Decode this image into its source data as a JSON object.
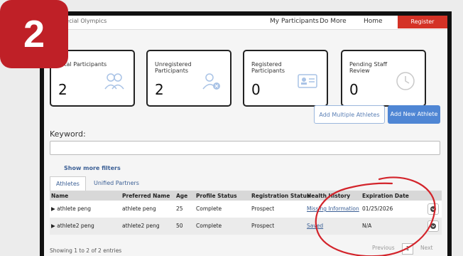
{
  "step_badge": "2",
  "nav": {
    "logo_text": "Special Olympics",
    "links": [
      "My Participants",
      "Do More",
      "Home"
    ],
    "cta": "Register"
  },
  "cards": [
    {
      "title": "Total Participants",
      "value": "2",
      "icon": "group-icon"
    },
    {
      "title": "Unregistered Participants",
      "value": "2",
      "icon": "user-remove-icon"
    },
    {
      "title": "Registered Participants",
      "value": "0",
      "icon": "id-card-icon"
    },
    {
      "title": "Pending Staff Review",
      "value": "0",
      "icon": "clock-icon"
    }
  ],
  "actions": {
    "add_multiple": "Add Multiple Athletes",
    "add_new": "Add New Athlete"
  },
  "search": {
    "label": "Keyword:",
    "placeholder": "",
    "value": ""
  },
  "filters_link": "Show more filters",
  "tabs": [
    "Athletes",
    "Unified Partners"
  ],
  "table": {
    "columns": [
      "Name",
      "Preferred Name",
      "Age",
      "Profile Status",
      "Registration Status",
      "Health History",
      "Expiration Date"
    ],
    "rows": [
      {
        "name": "▶ athlete peng",
        "preferred": "athlete peng",
        "age": "25",
        "profile": "Complete",
        "registration": "Prospect",
        "health": "Missing Information",
        "expiration": "01/25/2026"
      },
      {
        "name": "▶ athlete2 peng",
        "preferred": "athlete2 peng",
        "age": "50",
        "profile": "Complete",
        "registration": "Prospect",
        "health": "Saved",
        "expiration": "N/A"
      }
    ]
  },
  "footer": {
    "info": "Showing 1 to 2 of 2 entries",
    "prev": "Previous",
    "page": "1",
    "next": "Next"
  },
  "colors": {
    "badge": "#bf2027",
    "primary": "#4f86d4",
    "annotation": "#d3242b"
  }
}
